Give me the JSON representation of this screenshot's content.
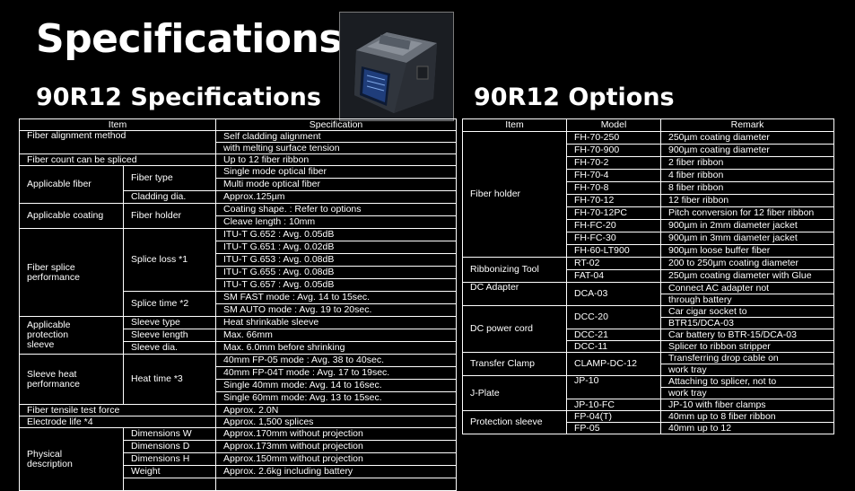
{
  "page": {
    "title": "Specifications",
    "specs_heading": "90R12 Specifications",
    "options_heading": "90R12 Options"
  },
  "specs": {
    "headers": {
      "item": "Item",
      "spec": "Specification"
    },
    "rows": {
      "fiber_alignment": {
        "item": "Fiber alignment method",
        "v1": "Self cladding alignment",
        "v2": "with melting surface tension"
      },
      "fiber_count": {
        "item": "Fiber count can be spliced",
        "value": "Up to 12 fiber ribbon"
      },
      "applicable_fiber": {
        "item": "Applicable fiber",
        "fiber_type": "Fiber type",
        "ft1": "Single mode optical fiber",
        "ft2": "Multi mode optical fiber",
        "cladding": "Cladding dia.",
        "cladding_val": "Approx.125µm"
      },
      "applicable_coating": {
        "item": "Applicable coating",
        "sub": "Fiber holder",
        "v1": "Coating shape. : Refer to options",
        "v2": "Cleave length : 10mm"
      },
      "splice_perf": {
        "item": "Fiber splice performance",
        "loss": "Splice loss *1",
        "loss_vals": [
          "ITU-T G.652 : Avg. 0.05dB",
          "ITU-T G.651 : Avg. 0.02dB",
          "ITU-T G.653 : Avg. 0.08dB",
          "ITU-T G.655 : Avg. 0.08dB",
          "ITU-T G.657 : Avg. 0.05dB"
        ],
        "time": "Splice time *2",
        "time_vals": [
          "SM FAST mode : Avg. 14 to 15sec.",
          "SM AUTO mode : Avg. 19 to 20sec."
        ]
      },
      "sleeve": {
        "item": "Applicable protection sleeve",
        "type": "Sleeve type",
        "type_val": "Heat shrinkable sleeve",
        "length": "Sleeve length",
        "length_val": "Max. 66mm",
        "dia": "Sleeve dia.",
        "dia_val": "Max. 6.0mm before shrinking"
      },
      "heat": {
        "item": "Sleeve heat performance",
        "sub": "Heat time *3",
        "vals": [
          "40mm FP-05 mode : Avg. 38 to 40sec.",
          "40mm FP-04T mode : Avg. 17 to 19sec.",
          "Single 40mm mode: Avg. 14 to 16sec.",
          "Single 60mm mode: Avg. 13 to 15sec."
        ]
      },
      "tensile": {
        "item": "Fiber tensile test force",
        "value": "Approx. 2.0N"
      },
      "electrode": {
        "item": "Electrode life *4",
        "value": "Approx. 1,500 splices"
      },
      "physical": {
        "item": "Physical description",
        "dw": "Dimensions W",
        "dw_val": "Approx.170mm without projection",
        "dd": "Dimensions D",
        "dd_val": "Approx.173mm without projection",
        "dh": "Dimensions H",
        "dh_val": "Approx.150mm without projection",
        "wt": "Weight",
        "wt_val": "Approx. 2.6kg including battery"
      }
    }
  },
  "options": {
    "headers": {
      "item": "Item",
      "model": "Model",
      "remark": "Remark"
    },
    "fiber_holder": {
      "item": "Fiber holder",
      "rows": [
        {
          "model": "FH-70-250",
          "remark": "250µm coating diameter"
        },
        {
          "model": "FH-70-900",
          "remark": "900µm coating diameter"
        },
        {
          "model": "FH-70-2",
          "remark": "2 fiber ribbon"
        },
        {
          "model": "FH-70-4",
          "remark": "4 fiber ribbon"
        },
        {
          "model": "FH-70-8",
          "remark": "8 fiber ribbon"
        },
        {
          "model": "FH-70-12",
          "remark": "12 fiber ribbon"
        },
        {
          "model": "FH-70-12PC",
          "remark": "Pitch conversion for 12 fiber ribbon"
        },
        {
          "model": "FH-FC-20",
          "remark": "900µm in 2mm diameter jacket"
        },
        {
          "model": "FH-FC-30",
          "remark": "900µm in 3mm diameter jacket"
        },
        {
          "model": "FH-60-LT900",
          "remark": "900µm loose buffer fiber"
        }
      ]
    },
    "ribbonizing": {
      "item": "Ribbonizing Tool",
      "rows": [
        {
          "model": "RT-02",
          "remark": "200 to 250µm coating diameter"
        },
        {
          "model": "FAT-04",
          "remark": "250µm coating diameter with Glue"
        }
      ]
    },
    "dc_adapter": {
      "item": "DC Adapter",
      "model": "DCA-03",
      "r1": "Connect AC adapter not",
      "r2": "through battery"
    },
    "dc_power": {
      "item": "DC power cord",
      "m1": "DCC-20",
      "m1r1": "Car cigar socket to",
      "m1r2": "BTR15/DCA-03",
      "m2": "DCC-21",
      "m2r": "Car battery to BTR-15/DCA-03",
      "m3": "DCC-11",
      "m3r": "Splicer to ribbon stripper"
    },
    "transfer_clamp": {
      "item": "Transfer Clamp",
      "model": "CLAMP-DC-12",
      "r1": "Transferring drop cable on",
      "r2": "work tray"
    },
    "j_plate": {
      "item": "J-Plate",
      "m1": "JP-10",
      "m1r1": "Attaching to splicer, not to",
      "m1r2": "work tray",
      "m2": "JP-10-FC",
      "m2r": "JP-10 with fiber clamps"
    },
    "protection_sleeve": {
      "item": "Protection sleeve",
      "m1": "FP-04(T)",
      "m1r": "40mm up to 8 fiber ribbon",
      "m2": "FP-05",
      "m2r": "40mm up to 12"
    }
  }
}
